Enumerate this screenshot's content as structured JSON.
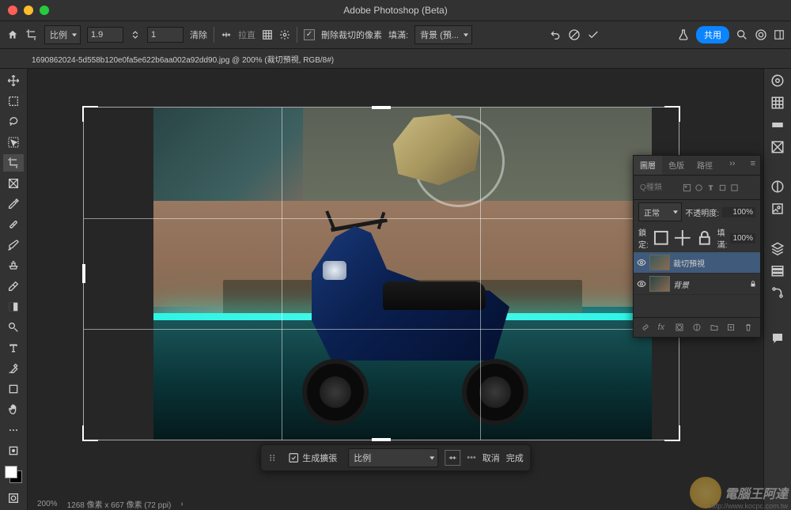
{
  "titlebar": {
    "title": "Adobe Photoshop (Beta)"
  },
  "optbar": {
    "ratio_label": "比例",
    "width": "1.9",
    "height": "1",
    "clear": "清除",
    "straighten": "拉直",
    "delete_cropped_checked": true,
    "delete_cropped": "刪除裁切的像素",
    "fill_label": "填滿:",
    "fill_value": "背景 (預...",
    "share": "共用"
  },
  "doctab": "1690862024-5d558b120e0fa5e622b6aa002a92dd90.jpg @ 200% (裁切預視, RGB/8#)",
  "statusbar": {
    "zoom": "200%",
    "info": "1268 像素 x 667 像素 (72 ppi)"
  },
  "contextbar": {
    "genfill": "生成擴張",
    "ratio": "比例",
    "cancel": "取消",
    "done": "完成"
  },
  "layers": {
    "tab1": "圖層",
    "tab2": "色版",
    "tab3": "路徑",
    "search_placeholder": "Q種類",
    "blend": "正常",
    "opacity_label": "不透明度:",
    "opacity": "100%",
    "lock_label": "鎖定:",
    "fill_label": "填滿:",
    "fill": "100%",
    "layer1": "裁切預視",
    "layer2": "背景"
  },
  "watermark": {
    "text": "電腦王阿達",
    "url": "http://www.kocpc.com.tw"
  }
}
